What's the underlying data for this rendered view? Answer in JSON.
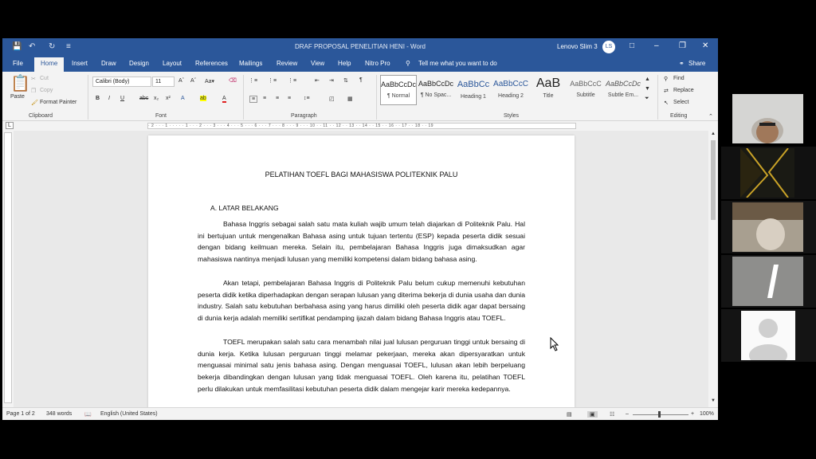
{
  "window": {
    "title": "DRAF PROPOSAL PENELITIAN HENI",
    "app": "Word",
    "title_full": "DRAF PROPOSAL PENELITIAN HENI  -  Word",
    "account_name": "Lenovo Slim 3",
    "account_initials": "LS"
  },
  "tabs": [
    "File",
    "Home",
    "Insert",
    "Draw",
    "Design",
    "Layout",
    "References",
    "Mailings",
    "Review",
    "View",
    "Help",
    "Nitro Pro"
  ],
  "tell_me": "Tell me what you want to do",
  "share_label": "Share",
  "ribbon": {
    "clipboard": {
      "paste": "Paste",
      "cut": "Cut",
      "copy": "Copy",
      "format_painter": "Format Painter",
      "label": "Clipboard"
    },
    "font": {
      "name": "Calibri (Body)",
      "size": "11",
      "label": "Font"
    },
    "paragraph": {
      "label": "Paragraph"
    },
    "styles": {
      "label": "Styles",
      "items": [
        {
          "sample": "AaBbCcDc",
          "name": "¶ Normal"
        },
        {
          "sample": "AaBbCcDc",
          "name": "¶ No Spac..."
        },
        {
          "sample": "AaBbCc",
          "name": "Heading 1"
        },
        {
          "sample": "AaBbCcC",
          "name": "Heading 2"
        },
        {
          "sample": "AaB",
          "name": "Title"
        },
        {
          "sample": "AaBbCcC",
          "name": "Subtitle"
        },
        {
          "sample": "AaBbCcDc",
          "name": "Subtle Em..."
        }
      ]
    },
    "editing": {
      "find": "Find",
      "replace": "Replace",
      "select": "Select",
      "label": "Editing"
    }
  },
  "ruler_text": "· 2 · · · 1 · · · · · 1 · · · 2 · · · 3 · · · 4 · · · 5 · · · 6 · · · 7 · · · 8 · · · 9 · · · 10 · · 11 · · 12 · · 13 · · 14 · · 15 · · 16 · · 17 · · 18 · · 19",
  "document": {
    "heading": "PELATIHAN TOEFL BAGI MAHASISWA POLITEKNIK PALU",
    "section": "A.    LATAR BELAKANG",
    "paragraphs": [
      "Bahasa Inggris sebagai salah satu mata kuliah wajib umum telah diajarkan di Politeknik Palu. Hal ini bertujuan untuk mengenalkan Bahasa asing untuk tujuan tertentu (ESP)  kepada peserta didik sesuai dengan bidang keilmuan mereka. Selain itu, pembelajaran Bahasa Inggris juga dimaksudkan agar mahasiswa nantinya menjadi lulusan yang memiliki kompetensi dalam bidang bahasa asing.",
      "Akan tetapi, pembelajaran Bahasa Inggris di Politeknik Palu belum cukup memenuhi kebutuhan peserta didik ketika diperhadapkan dengan serapan lulusan yang diterima bekerja di dunia usaha dan dunia industry. Salah satu kebutuhan berbahasa asing yang harus dimiliki oleh peserta didik agar dapat bersaing di dunia kerja adalah memiliki sertifikat pendamping ijazah dalam bidang Bahasa Inggris atau TOEFL.",
      "TOEFL merupakan salah satu cara menambah nilai jual lulusan perguruan tinggi untuk bersaing di dunia kerja. Ketika lulusan perguruan tinggi melamar pekerjaan, mereka akan dipersyaratkan untuk menguasai minimal satu jenis bahasa asing. Dengan menguasai TOEFL, lulusan akan lebih berpeluang bekerja dibandingkan dengan lulusan yang tidak menguasai TOEFL. Oleh karena itu, pelatihan TOEFL perlu dilakukan untuk memfasilitasi kebutuhan peserta didik dalam mengejar karir mereka kedepannya."
    ]
  },
  "status": {
    "page": "Page 1 of 2",
    "words": "348 words",
    "language": "English (United States)",
    "zoom": "100%"
  },
  "colors": {
    "ribbon_blue": "#2b579a",
    "spell_red": "#e02020"
  }
}
